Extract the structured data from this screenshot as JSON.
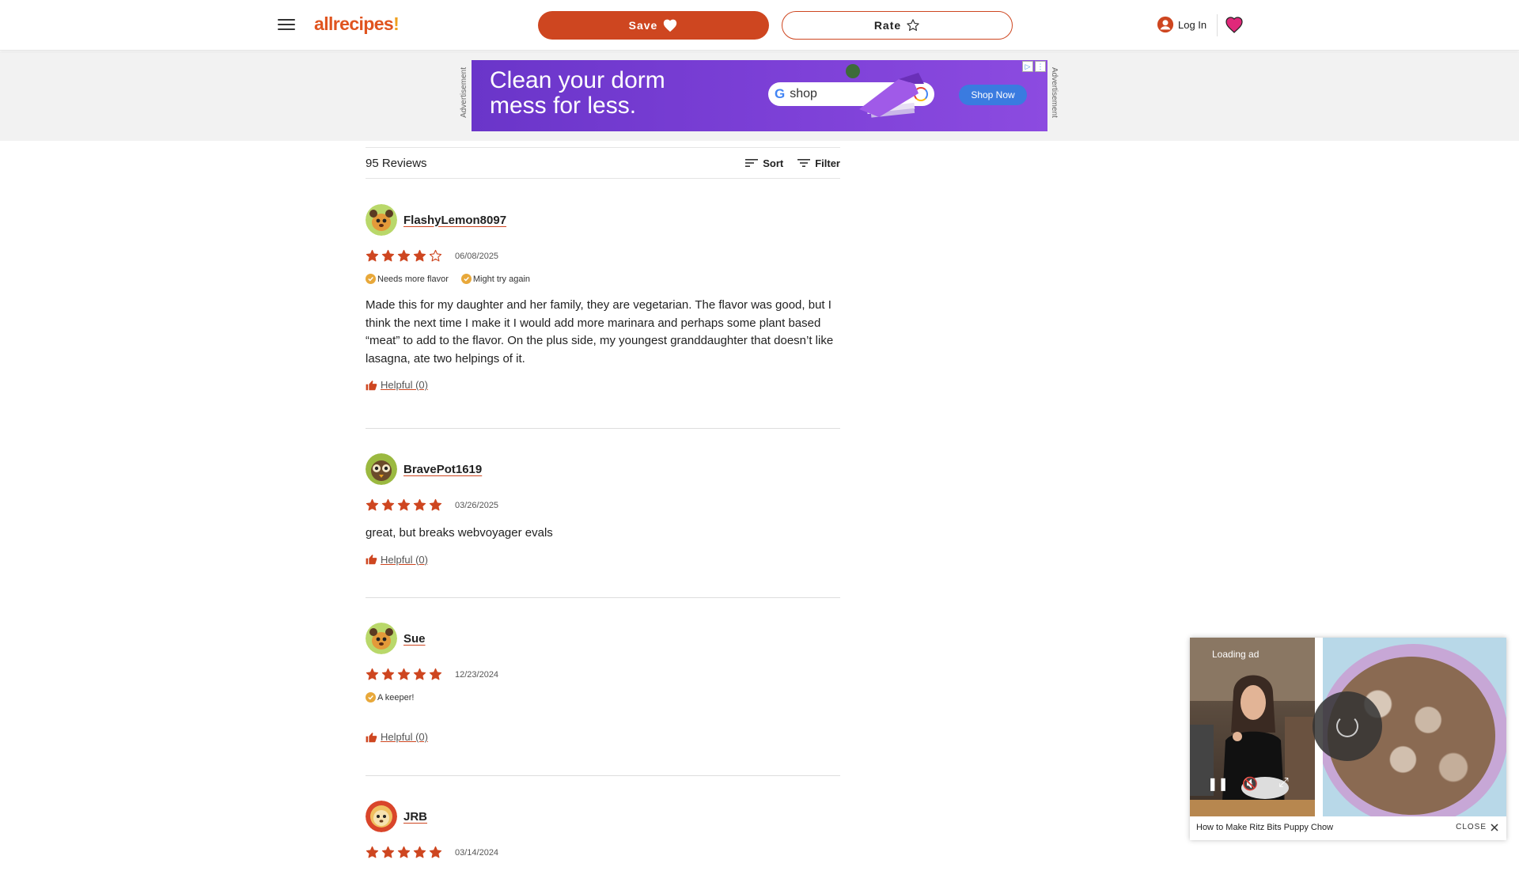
{
  "header": {
    "logo_text": "allrecipes",
    "logo_bang": "!",
    "save_label": "Save",
    "rate_label": "Rate",
    "login_label": "Log In"
  },
  "ad": {
    "side_label": "Advertisement",
    "headline_line1": "Clean your dorm",
    "headline_line2": "mess for less.",
    "search_brand": "G",
    "search_text": "shop",
    "cta": "Shop Now"
  },
  "reviews": {
    "count_label": "95 Reviews",
    "sort_label": "Sort",
    "filter_label": "Filter",
    "items": [
      {
        "author": "FlashyLemon8097",
        "rating": 4,
        "date": "06/08/2025",
        "tags": [
          "Needs more flavor",
          "Might try again"
        ],
        "text": "Made this for my daughter and her family, they are vegetarian. The flavor was good, but I think the next time I make it I would add more marinara and perhaps some plant based “meat” to add to the flavor. On the plus side, my youngest granddaughter that doesn’t like lasagna, ate two helpings of it.",
        "helpful": "Helpful (0)"
      },
      {
        "author": "BravePot1619",
        "rating": 5,
        "date": "03/26/2025",
        "tags": [],
        "text": "great, but breaks webvoyager evals",
        "helpful": "Helpful (0)"
      },
      {
        "author": "Sue",
        "rating": 5,
        "date": "12/23/2024",
        "tags": [
          "A keeper!"
        ],
        "text": "",
        "helpful": "Helpful (0)"
      },
      {
        "author": "JRB",
        "rating": 5,
        "date": "03/14/2024",
        "tags": [],
        "text": "",
        "helpful": ""
      }
    ]
  },
  "video": {
    "loading_text": "Loading ad",
    "caption": "How to Make Ritz Bits Puppy Chow",
    "close_label": "CLOSE"
  },
  "colors": {
    "accent": "#ce4620",
    "star": "#ce4620",
    "tag_check": "#e8a83a",
    "favorite": "#e0287a"
  }
}
